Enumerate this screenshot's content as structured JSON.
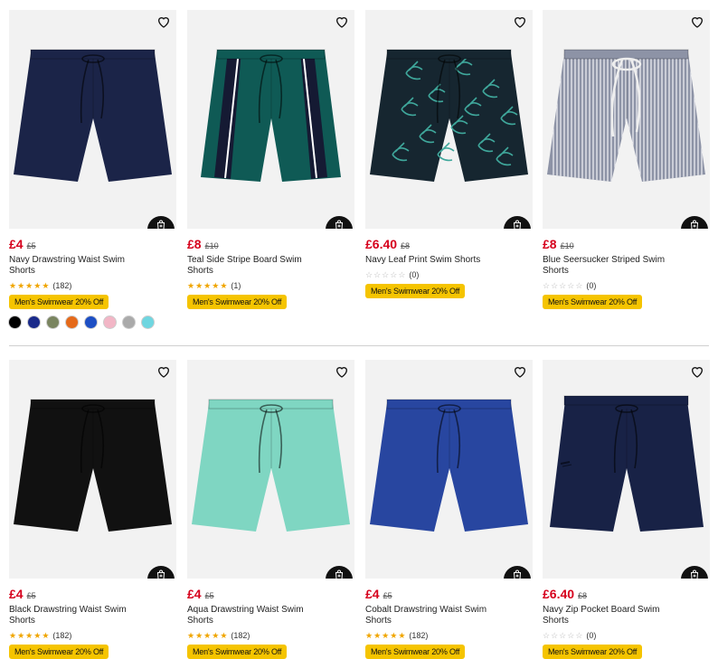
{
  "promo_label": "Men's Swimwear 20% Off",
  "add_label": "Add",
  "products": [
    {
      "name": "Navy Drawstring Waist Swim Shorts",
      "price": "£4",
      "was": "£5",
      "reviews": "(182)",
      "stars": 4.5,
      "color": "#1b2448",
      "style": "plain",
      "swatches": [
        "#000000",
        "#1a2a8a",
        "#7a8560",
        "#e56a1a",
        "#1d4fc4",
        "#f2b6c6",
        "#aaaaaa",
        "#6fd6e0"
      ]
    },
    {
      "name": "Teal Side Stripe Board Swim Shorts",
      "price": "£8",
      "was": "£10",
      "reviews": "(1)",
      "stars": 5,
      "color": "#0f5a55",
      "style": "stripe"
    },
    {
      "name": "Navy Leaf Print Swim Shorts",
      "price": "£6.40",
      "was": "£8",
      "reviews": "(0)",
      "stars": 0,
      "color": "#162630",
      "style": "leaf"
    },
    {
      "name": "Blue Seersucker Striped Swim Shorts",
      "price": "£8",
      "was": "£10",
      "reviews": "(0)",
      "stars": 0,
      "color": "#8d93a6",
      "style": "seersucker"
    },
    {
      "name": "Black Drawstring Waist Swim Shorts",
      "price": "£4",
      "was": "£5",
      "reviews": "(182)",
      "stars": 4.5,
      "color": "#111111",
      "style": "plain"
    },
    {
      "name": "Aqua Drawstring Waist Swim Shorts",
      "price": "£4",
      "was": "£5",
      "reviews": "(182)",
      "stars": 4.5,
      "color": "#7fd6c2",
      "style": "plain"
    },
    {
      "name": "Cobalt Drawstring Waist Swim Shorts",
      "price": "£4",
      "was": "£5",
      "reviews": "(182)",
      "stars": 4.5,
      "color": "#2846a0",
      "style": "plain"
    },
    {
      "name": "Navy Zip Pocket Board Swim Shorts",
      "price": "£6.40",
      "was": "£8",
      "reviews": "(0)",
      "stars": 0,
      "color": "#182246",
      "style": "board"
    }
  ]
}
